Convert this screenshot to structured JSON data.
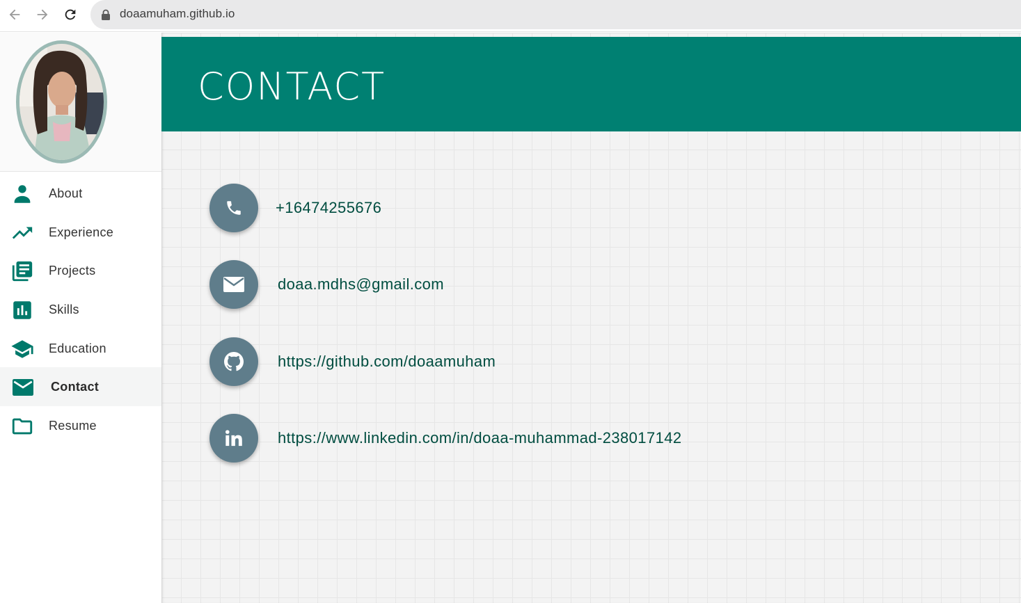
{
  "browser": {
    "url": "doaamuham.github.io",
    "icons": [
      "back-arrow-icon",
      "forward-arrow-icon",
      "reload-icon",
      "lock-icon"
    ]
  },
  "sidebar": {
    "items": [
      {
        "label": "About",
        "icon": "person-icon"
      },
      {
        "label": "Experience",
        "icon": "trending-up-icon"
      },
      {
        "label": "Projects",
        "icon": "library-books-icon"
      },
      {
        "label": "Skills",
        "icon": "bar-chart-icon"
      },
      {
        "label": "Education",
        "icon": "graduation-cap-icon"
      },
      {
        "label": "Contact",
        "icon": "email-icon",
        "active": true
      },
      {
        "label": "Resume",
        "icon": "folder-icon"
      }
    ]
  },
  "main": {
    "title": "CONTACT",
    "contacts": [
      {
        "icon": "phone-icon",
        "text": "+16474255676"
      },
      {
        "icon": "envelope-icon",
        "text": "doaa.mdhs@gmail.com"
      },
      {
        "icon": "github-icon",
        "text": "https://github.com/doaamuham"
      },
      {
        "icon": "linkedin-icon",
        "text": "https://www.linkedin.com/in/doaa-muhammad-238017142"
      }
    ]
  },
  "colors": {
    "accent": "#008072",
    "icon_teal": "#00796b",
    "contact_circle": "#5f7d8b",
    "link_text": "#004d40"
  }
}
